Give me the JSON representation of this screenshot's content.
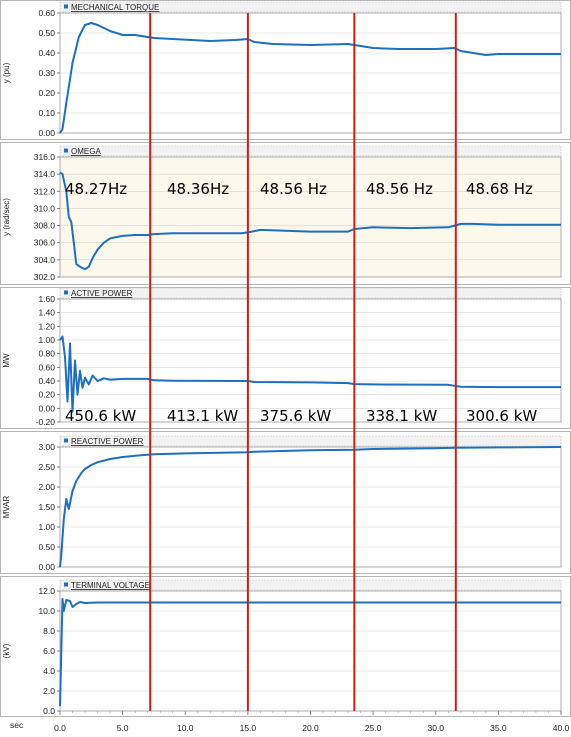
{
  "chart_data": {
    "type": "line",
    "x_axis": {
      "label": "sec",
      "range": [
        0,
        40
      ],
      "ticks": [
        "0.0",
        "5.0",
        "10.0",
        "15.0",
        "20.0",
        "25.0",
        "30.0",
        "35.0",
        "40.0"
      ]
    },
    "panels": [
      {
        "title": "MECHANICAL TORQUE",
        "ylabel": "y (pu)",
        "ylim": [
          0,
          0.6
        ],
        "ticks": [
          "0.00",
          "0.10",
          "0.20",
          "0.30",
          "0.40",
          "0.50",
          "0.60"
        ],
        "series": [
          {
            "x": [
              0,
              0.2,
              0.5,
              1.0,
              1.5,
              2.0,
              2.5,
              3.0,
              4.0,
              5.0,
              6.0,
              7.0,
              7.5,
              9,
              12,
              14,
              15,
              15.5,
              17,
              20,
              23,
              23.5,
              25,
              27,
              30,
              31.5,
              32,
              33,
              34,
              35,
              37,
              40
            ],
            "y": [
              0,
              0.02,
              0.15,
              0.35,
              0.48,
              0.54,
              0.55,
              0.54,
              0.51,
              0.49,
              0.49,
              0.48,
              0.475,
              0.47,
              0.46,
              0.465,
              0.47,
              0.455,
              0.445,
              0.44,
              0.445,
              0.44,
              0.425,
              0.42,
              0.42,
              0.425,
              0.41,
              0.4,
              0.39,
              0.395,
              0.395,
              0.395
            ]
          }
        ]
      },
      {
        "title": "OMEGA",
        "ylabel": "y (rad/sec)",
        "ylim": [
          302,
          316
        ],
        "ticks": [
          "302.0",
          "304.0",
          "306.0",
          "308.0",
          "310.0",
          "312.0",
          "314.0",
          "316.0"
        ],
        "background": "#fdf8ec",
        "series": [
          {
            "x": [
              0,
              0.2,
              0.5,
              0.7,
              0.9,
              1.1,
              1.3,
              1.6,
              2.0,
              2.3,
              2.6,
              3.0,
              3.5,
              4.0,
              5.0,
              6.0,
              7.0,
              7.5,
              9,
              12,
              14.5,
              15,
              16,
              20,
              23,
              23.5,
              25,
              28,
              31,
              31.5,
              32,
              33,
              35,
              40
            ],
            "y": [
              314.2,
              314,
              312,
              309,
              308.4,
              306,
              303.5,
              303.2,
              302.9,
              303.2,
              304.2,
              305.2,
              306,
              306.5,
              306.8,
              306.9,
              306.9,
              307,
              307.1,
              307.1,
              307.1,
              307.2,
              307.5,
              307.3,
              307.3,
              307.6,
              307.8,
              307.7,
              307.8,
              308,
              308.2,
              308.2,
              308.1,
              308.1
            ]
          }
        ],
        "annotations": [
          "48.27Hz",
          "48.36Hz",
          "48.56 Hz",
          "48.56 Hz",
          "48.68 Hz"
        ]
      },
      {
        "title": "ACTIVE POWER",
        "ylabel": "MW",
        "ylim": [
          -0.2,
          1.6
        ],
        "ticks": [
          "-0.20",
          "0.00",
          "0.20",
          "0.40",
          "0.60",
          "0.80",
          "1.00",
          "1.20",
          "1.40",
          "1.60"
        ],
        "series": [
          {
            "x": [
              0,
              0.2,
              0.4,
              0.6,
              0.8,
              1.0,
              1.2,
              1.4,
              1.6,
              1.8,
              2.0,
              2.3,
              2.6,
              3.0,
              3.5,
              4.0,
              5.0,
              7.0,
              7.5,
              9,
              15,
              15.5,
              20,
              23,
              23.5,
              25,
              31,
              31.5,
              32,
              35,
              40
            ],
            "y": [
              1.0,
              1.05,
              0.75,
              0.1,
              0.95,
              -0.05,
              0.7,
              0.2,
              0.55,
              0.3,
              0.45,
              0.35,
              0.48,
              0.4,
              0.44,
              0.42,
              0.43,
              0.43,
              0.41,
              0.405,
              0.4,
              0.385,
              0.38,
              0.37,
              0.355,
              0.35,
              0.345,
              0.33,
              0.315,
              0.31,
              0.31
            ]
          }
        ],
        "annotations": [
          "450.6 kW",
          "413.1 kW",
          "375.6 kW",
          "338.1 kW",
          "300.6 kW"
        ]
      },
      {
        "title": "REACTIVE POWER",
        "ylabel": "MVAR",
        "ylim": [
          0,
          3.0
        ],
        "ticks": [
          "0.00",
          "0.50",
          "1.00",
          "1.50",
          "2.00",
          "2.50",
          "3.00"
        ],
        "series": [
          {
            "x": [
              0,
              0.1,
              0.3,
              0.5,
              0.7,
              1.0,
              1.3,
              1.7,
              2.0,
              2.5,
              3.0,
              4.0,
              5.0,
              6.0,
              7.5,
              10,
              15,
              15.5,
              20,
              23.5,
              25,
              30,
              31.5,
              35,
              40
            ],
            "y": [
              0,
              0.3,
              1.2,
              1.7,
              1.45,
              1.9,
              2.15,
              2.35,
              2.45,
              2.55,
              2.62,
              2.7,
              2.75,
              2.78,
              2.82,
              2.84,
              2.87,
              2.88,
              2.92,
              2.93,
              2.95,
              2.97,
              2.98,
              2.99,
              3.0
            ]
          }
        ]
      },
      {
        "title": "TERMINAL VOLTAGE",
        "ylabel": "(kV)",
        "ylim": [
          0,
          12.0
        ],
        "ticks": [
          "0.0",
          "2.0",
          "4.0",
          "6.0",
          "8.0",
          "10.0",
          "12.0"
        ],
        "series": [
          {
            "x": [
              0,
              0.1,
              0.2,
              0.3,
              0.5,
              0.8,
              1.0,
              1.3,
              1.6,
              2.0,
              3.0,
              5.0,
              10,
              20,
              30,
              40
            ],
            "y": [
              0.5,
              6,
              11.2,
              10,
              11.1,
              11,
              10.4,
              10.7,
              10.9,
              10.8,
              10.85,
              10.85,
              10.85,
              10.85,
              10.85,
              10.85
            ]
          }
        ]
      }
    ],
    "vertical_markers": [
      7.2,
      15.0,
      23.5,
      31.6
    ],
    "colors": {
      "series": "#1f6fbf",
      "marker": "#c8201a",
      "grid": "#d4d4d4",
      "title_bar": "#f2f2f2"
    }
  }
}
